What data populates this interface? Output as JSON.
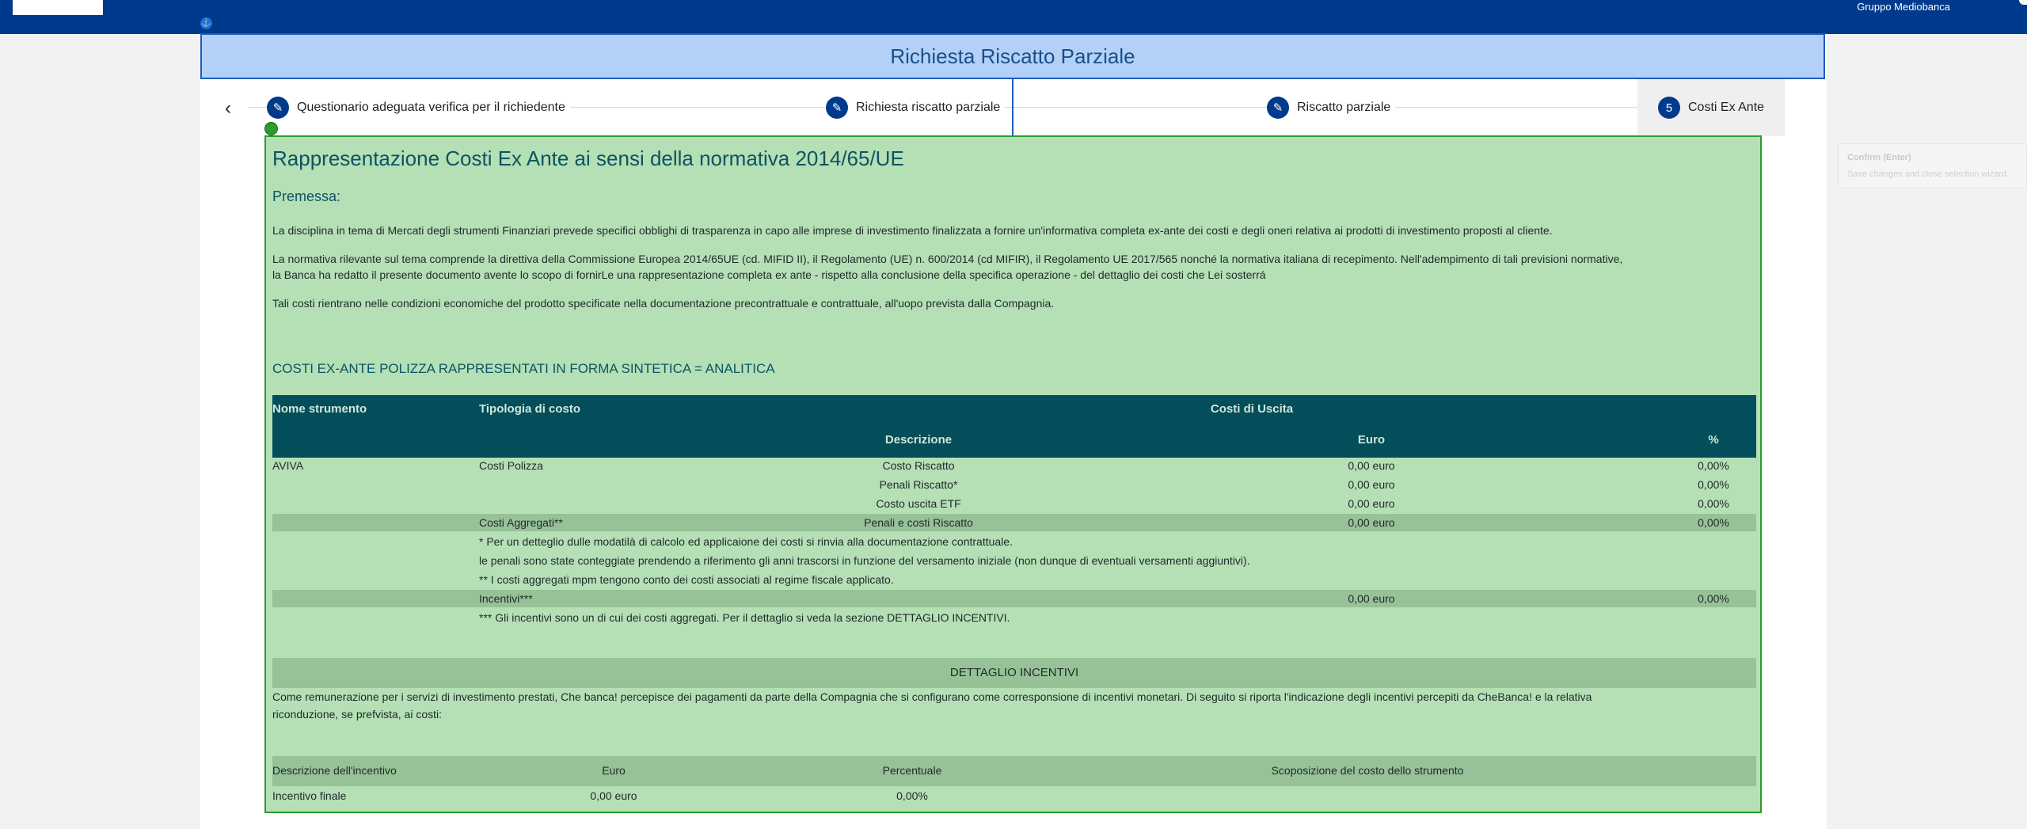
{
  "header": {
    "brand": "Gruppo Mediobanca"
  },
  "title": "Richiesta Riscatto Parziale",
  "stepper": {
    "steps": [
      {
        "label": "Questionario adeguata verifica per il richiedente",
        "marker": "✎"
      },
      {
        "label": "Richiesta riscatto parziale",
        "marker": "✎"
      },
      {
        "label": "Riscatto parziale",
        "marker": "✎"
      },
      {
        "label": "Costi Ex Ante",
        "marker": "5"
      }
    ]
  },
  "content": {
    "heading": "Rappresentazione Costi Ex Ante ai sensi della normativa 2014/65/UE",
    "premessa": "Premessa:",
    "para1": "La disciplina in tema di Mercati degli strumenti Finanziari prevede specifici obblighi di trasparenza in capo alle imprese di investimento finalizzata a fornire un'informativa completa ex-ante dei costi e degli oneri relativa ai prodotti di investimento proposti al cliente.",
    "para2a": "La normativa rilevante sul tema comprende la direttiva della Commissione Europea 2014/65UE (cd. MIFID II), il Regolamento (UE) n. 600/2014 (cd MIFIR), il Regolamento UE 2017/565 nonché la normativa italiana di recepimento. Nell'adempimento di tali previsioni normative,",
    "para2b": "la Banca ha redatto il presente documento avente lo scopo di fornirLe una rappresentazione completa ex ante - rispetto alla conclusione della specifica operazione - del dettaglio dei costi che Lei sosterrá",
    "para3": "Tali costi rientrano nelle condizioni economiche del prodotto specificate nella documentazione precontrattuale e contrattuale, all'uopo prevista dalla Compagnia.",
    "costs_title": "COSTI EX-ANTE POLIZZA RAPPRESENTATI IN FORMA SINTETICA = ANALITICA",
    "costs_table": {
      "h_instrument": "Nome strumento",
      "h_type": "Tipologia di costo",
      "h_exit": "Costi di Uscita",
      "h_desc": "Descrizione",
      "h_euro": "Euro",
      "h_pct": "%",
      "instrument": "AVIVA",
      "type1": "Costi Polizza",
      "rows": [
        {
          "desc": "Costo Riscatto",
          "euro": "0,00 euro",
          "pct": "0,00%"
        },
        {
          "desc": "Penali Riscatto*",
          "euro": "0,00 euro",
          "pct": "0,00%"
        },
        {
          "desc": "Costo uscita ETF",
          "euro": "0,00 euro",
          "pct": "0,00%"
        }
      ],
      "aggregati": {
        "label": "Costi Aggregati**",
        "desc": "Penali e costi Riscatto",
        "euro": "0,00 euro",
        "pct": "0,00%"
      },
      "note1": "* Per un detteglio dulle modatilà di calcolo ed applicaione dei costi si rinvia alla documentazione contrattuale.",
      "note2": "le penali sono state conteggiate prendendo a riferimento gli anni trascorsi in funzione del versamento iniziale (non dunque di eventuali versamenti aggiuntivi).",
      "note3": "** I costi aggregati mpm tengono conto dei costi associati al regime fiscale applicato.",
      "incentivi": {
        "label": "Incentivi***",
        "euro": "0,00 euro",
        "pct": "0,00%"
      },
      "note4": "*** Gli incentivi sono un di cui dei costi aggregati. Per il dettaglio si veda la sezione DETTAGLIO INCENTIVI."
    },
    "detail_title": "DETTAGLIO INCENTIVI",
    "detail_text_a": "Come remunerazione per i servizi di investimento prestati, Che banca! percepisce dei pagamenti da parte della Compagnia che si configurano come corresponsione di incentivi monetari. Di seguito si riporta l'indicazione degli incentivi percepiti da CheBanca! e la relativa",
    "detail_text_b": "riconduzione, se prefvista, ai costi:",
    "incentives_table": {
      "h_desc": "Descrizione dell'incentivo",
      "h_euro": "Euro",
      "h_pct": "Percentuale",
      "h_split": "Scoposizione del costo dello strumento",
      "row_desc": "Incentivo finale",
      "row_euro": "0,00 euro",
      "row_pct": "0,00%"
    }
  },
  "tooltip": {
    "title": "Confirm (Enter)",
    "text": "Save changes and close selection wizard."
  },
  "colors": {
    "topbar": "#003a8c",
    "panel_bg": "#b5dfb5",
    "panel_border": "#2e9a2e",
    "table_header": "#044d5b",
    "band": "#97c297",
    "title_band": "#b3d1f7"
  }
}
